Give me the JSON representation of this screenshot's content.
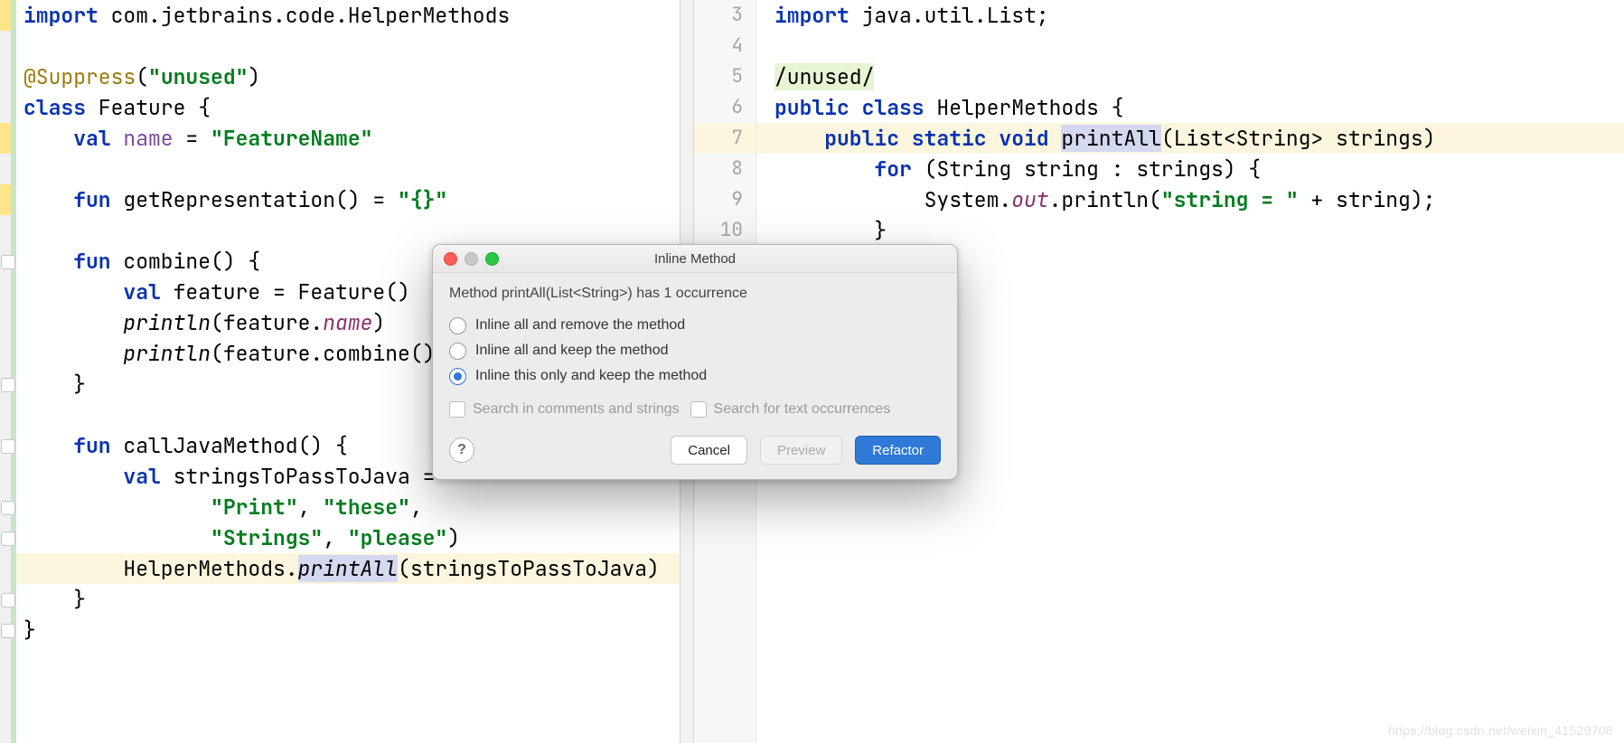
{
  "leftEditor": {
    "lines": [
      {
        "tokens": [
          {
            "t": "import ",
            "c": "kw"
          },
          {
            "t": "com.jetbrains.code.HelperMethods"
          }
        ]
      },
      {
        "tokens": [
          {
            "t": " "
          }
        ]
      },
      {
        "tokens": [
          {
            "t": "@Suppress",
            "c": "ann"
          },
          {
            "t": "("
          },
          {
            "t": "\"unused\"",
            "c": "str"
          },
          {
            "t": ")"
          }
        ]
      },
      {
        "tokens": [
          {
            "t": "class ",
            "c": "kw"
          },
          {
            "t": "Feature {"
          }
        ]
      },
      {
        "tokens": [
          {
            "t": "    "
          },
          {
            "t": "val ",
            "c": "kw"
          },
          {
            "t": "name",
            "c": "id-purple"
          },
          {
            "t": " = "
          },
          {
            "t": "\"FeatureName\"",
            "c": "str"
          }
        ]
      },
      {
        "tokens": [
          {
            "t": " "
          }
        ]
      },
      {
        "tokens": [
          {
            "t": "    "
          },
          {
            "t": "fun ",
            "c": "kw"
          },
          {
            "t": "getRepresentation() = "
          },
          {
            "t": "\"{}\"",
            "c": "str"
          }
        ]
      },
      {
        "tokens": [
          {
            "t": " "
          }
        ]
      },
      {
        "tokens": [
          {
            "t": "    "
          },
          {
            "t": "fun ",
            "c": "kw"
          },
          {
            "t": "combine() {"
          }
        ]
      },
      {
        "tokens": [
          {
            "t": "        "
          },
          {
            "t": "val ",
            "c": "kw"
          },
          {
            "t": "feature = Feature()"
          }
        ]
      },
      {
        "tokens": [
          {
            "t": "        "
          },
          {
            "t": "println",
            "c": "it"
          },
          {
            "t": "(feature."
          },
          {
            "t": "name",
            "c": "field-it"
          },
          {
            "t": ")"
          }
        ]
      },
      {
        "tokens": [
          {
            "t": "        "
          },
          {
            "t": "println",
            "c": "it"
          },
          {
            "t": "(feature.combine())"
          }
        ]
      },
      {
        "tokens": [
          {
            "t": "    }"
          }
        ]
      },
      {
        "tokens": [
          {
            "t": " "
          }
        ]
      },
      {
        "tokens": [
          {
            "t": "    "
          },
          {
            "t": "fun ",
            "c": "kw"
          },
          {
            "t": "callJavaMethod() {"
          }
        ]
      },
      {
        "tokens": [
          {
            "t": "        "
          },
          {
            "t": "val ",
            "c": "kw"
          },
          {
            "t": "stringsToPassToJava = "
          }
        ]
      },
      {
        "tokens": [
          {
            "t": "               "
          },
          {
            "t": "\"Print\"",
            "c": "str"
          },
          {
            "t": ", "
          },
          {
            "t": "\"these\"",
            "c": "str"
          },
          {
            "t": ","
          }
        ]
      },
      {
        "tokens": [
          {
            "t": "               "
          },
          {
            "t": "\"Strings\"",
            "c": "str"
          },
          {
            "t": ", "
          },
          {
            "t": "\"please\"",
            "c": "str"
          },
          {
            "t": ")"
          }
        ]
      },
      {
        "tokens": [
          {
            "t": "        HelperMethods."
          },
          {
            "t": "printAll",
            "c": "it",
            "sel": true
          },
          {
            "t": "(stringsToPassToJava)"
          }
        ],
        "rowHl": true
      },
      {
        "tokens": [
          {
            "t": "    }"
          }
        ]
      },
      {
        "tokens": [
          {
            "t": "}"
          }
        ]
      }
    ],
    "yellowBars": [
      0,
      4,
      6
    ],
    "foldIcons": [
      8,
      12,
      14,
      16,
      17,
      19,
      20
    ]
  },
  "rightEditor": {
    "startLine": 3,
    "highlightedIndex": 4,
    "lines": [
      {
        "tokens": [
          {
            "t": "import ",
            "c": "kw"
          },
          {
            "t": "java.util.List;"
          }
        ]
      },
      {
        "tokens": [
          {
            "t": " "
          }
        ]
      },
      {
        "tokens": [
          {
            "t": "/unused/"
          }
        ],
        "bg": "#e7f5d3"
      },
      {
        "tokens": [
          {
            "t": "public class ",
            "c": "kw"
          },
          {
            "t": "HelperMethods {"
          }
        ]
      },
      {
        "tokens": [
          {
            "t": "    "
          },
          {
            "t": "public static void ",
            "c": "kw"
          },
          {
            "t": "printAll",
            "sel": true
          },
          {
            "t": "(List<String> strings)"
          }
        ],
        "rowHl": true
      },
      {
        "tokens": [
          {
            "t": "        "
          },
          {
            "t": "for ",
            "c": "kw"
          },
          {
            "t": "(String string : strings) {"
          }
        ]
      },
      {
        "tokens": [
          {
            "t": "            System."
          },
          {
            "t": "out",
            "c": "field-it"
          },
          {
            "t": ".println("
          },
          {
            "t": "\"string = \"",
            "c": "str"
          },
          {
            "t": " + string);"
          }
        ]
      },
      {
        "tokens": [
          {
            "t": "        }"
          }
        ]
      }
    ]
  },
  "dialog": {
    "title": "Inline Method",
    "message": "Method printAll(List<String>) has 1 occurrence",
    "options": [
      "Inline all and remove the method",
      "Inline all and keep the method",
      "Inline this only and keep the method"
    ],
    "selected": 2,
    "check1": "Search in comments and strings",
    "check2": "Search for text occurrences",
    "help": "?",
    "cancel": "Cancel",
    "preview": "Preview",
    "refactor": "Refactor"
  },
  "watermark": "https://blog.csdn.net/weixin_41529708"
}
